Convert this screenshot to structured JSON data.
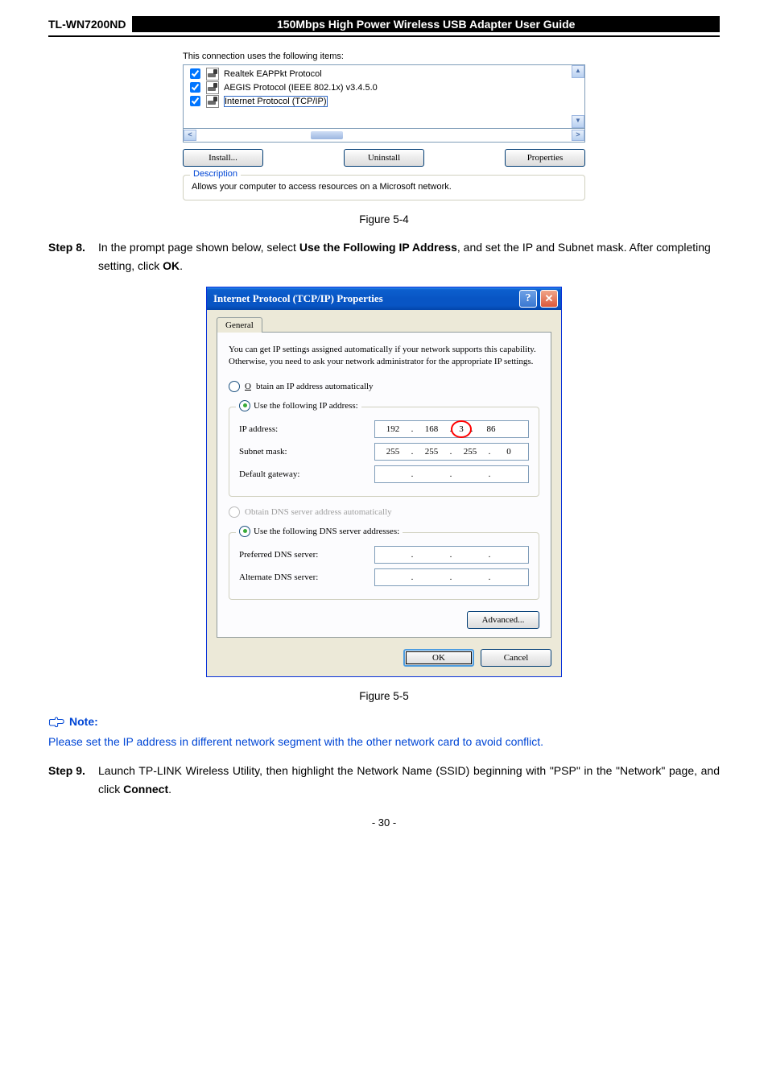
{
  "header": {
    "model": "TL-WN7200ND",
    "guide": "150Mbps High Power Wireless USB Adapter User Guide"
  },
  "g1": {
    "caption": "This connection uses the following items:",
    "items": [
      "Realtek EAPPkt Protocol",
      "AEGIS Protocol (IEEE 802.1x) v3.4.5.0",
      "Internet Protocol (TCP/IP)"
    ],
    "install": "Install...",
    "uninstall": "Uninstall",
    "properties": "Properties",
    "desc_title": "Description",
    "desc_text": "Allows your computer to access resources on a Microsoft network."
  },
  "fig1": "Figure 5-4",
  "step8": {
    "label": "Step 8.",
    "text_pre": "In the prompt page shown below, select ",
    "bold1": "Use the Following IP Address",
    "mid": ", and set the IP and Subnet mask. After completing setting, click ",
    "bold2": "OK",
    "post": "."
  },
  "dlg": {
    "title": "Internet Protocol (TCP/IP) Properties",
    "tab": "General",
    "intro": "You can get IP settings assigned automatically if your network supports this capability. Otherwise, you need to ask your network administrator for the appropriate IP settings.",
    "opt_auto_ip": "Obtain an IP address automatically",
    "opt_use_ip": "Use the following IP address:",
    "ip_label": "IP address:",
    "ip": [
      "192",
      "168",
      "3",
      "86"
    ],
    "subnet_label": "Subnet mask:",
    "subnet": [
      "255",
      "255",
      "255",
      "0"
    ],
    "gw_label": "Default gateway:",
    "gw": [
      "",
      "",
      "",
      ""
    ],
    "opt_auto_dns": "Obtain DNS server address automatically",
    "opt_use_dns": "Use the following DNS server addresses:",
    "pref_label": "Preferred DNS server:",
    "alt_label": "Alternate DNS server:",
    "advanced": "Advanced...",
    "ok": "OK",
    "cancel": "Cancel"
  },
  "fig2": "Figure 5-5",
  "note_label": "Note:",
  "note_text": "Please set the IP address in different network segment with the other network card to avoid conflict.",
  "step9": {
    "label": "Step 9.",
    "text_pre": "Launch TP-LINK Wireless Utility, then highlight the Network Name (SSID) beginning with \"PSP\" in the \"Network\" page, and click ",
    "bold": "Connect",
    "post": "."
  },
  "footer": "- 30 -"
}
